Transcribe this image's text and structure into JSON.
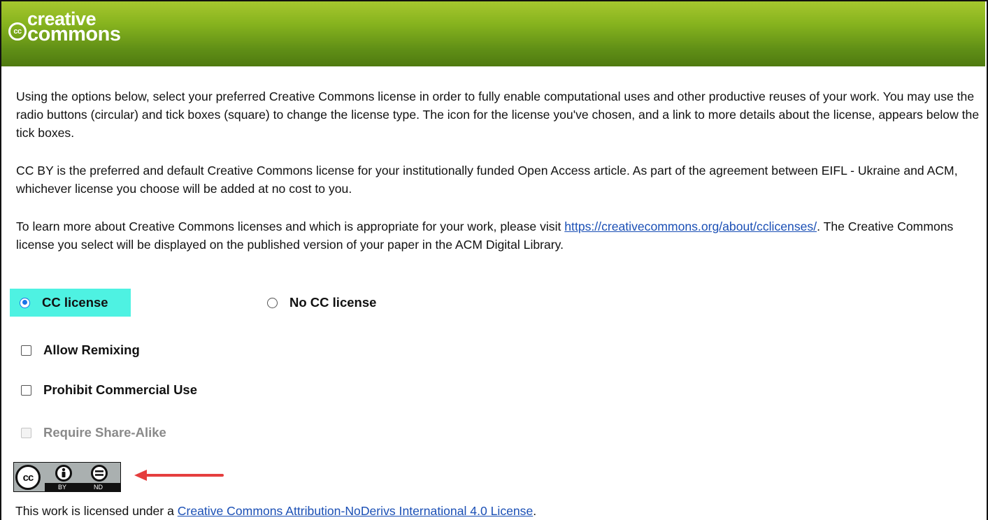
{
  "header": {
    "logo_word1": "creative",
    "logo_word2": "commons",
    "logo_cc": "cc"
  },
  "intro": {
    "p1": "Using the options below, select your preferred Creative Commons license in order to fully enable computational uses and other productive reuses of your work. You may use the radio buttons (circular) and tick boxes (square) to change the license type. The icon for the license you've chosen, and a link to more details about the license, appears below the tick boxes.",
    "p2": "CC BY is the preferred and default Creative Commons license for your institutionally funded Open Access article. As part of the agreement between EIFL - Ukraine and ACM, whichever license you choose will be added at no cost to you.",
    "p3_before": "To learn more about Creative Commons licenses and which is appropriate for your work, please visit ",
    "p3_link": "https://creativecommons.org/about/cclicenses/",
    "p3_after": ". The Creative Commons license you select will be displayed on the published version of your paper in the ACM Digital Library."
  },
  "license_choice": {
    "cc_label": "CC license",
    "no_cc_label": "No CC license",
    "selected": "CC license",
    "highlight_color": "#4ef2e2"
  },
  "options": {
    "allow_remixing": "Allow Remixing",
    "prohibit_commercial": "Prohibit Commercial Use",
    "share_alike": "Require Share-Alike"
  },
  "badge": {
    "cc": "cc",
    "by": "BY",
    "nd": "ND"
  },
  "footer": {
    "prefix": "This work is licensed under a ",
    "link": "Creative Commons Attribution-NoDerivs International 4.0 License",
    "suffix": "."
  },
  "colors": {
    "header_green": "#7fae1c",
    "link_blue": "#1a4fb5",
    "arrow_red": "#e53e3e"
  },
  "icons": [
    "cc-logo-icon",
    "attribution-icon",
    "no-derivatives-icon",
    "arrow-icon"
  ]
}
